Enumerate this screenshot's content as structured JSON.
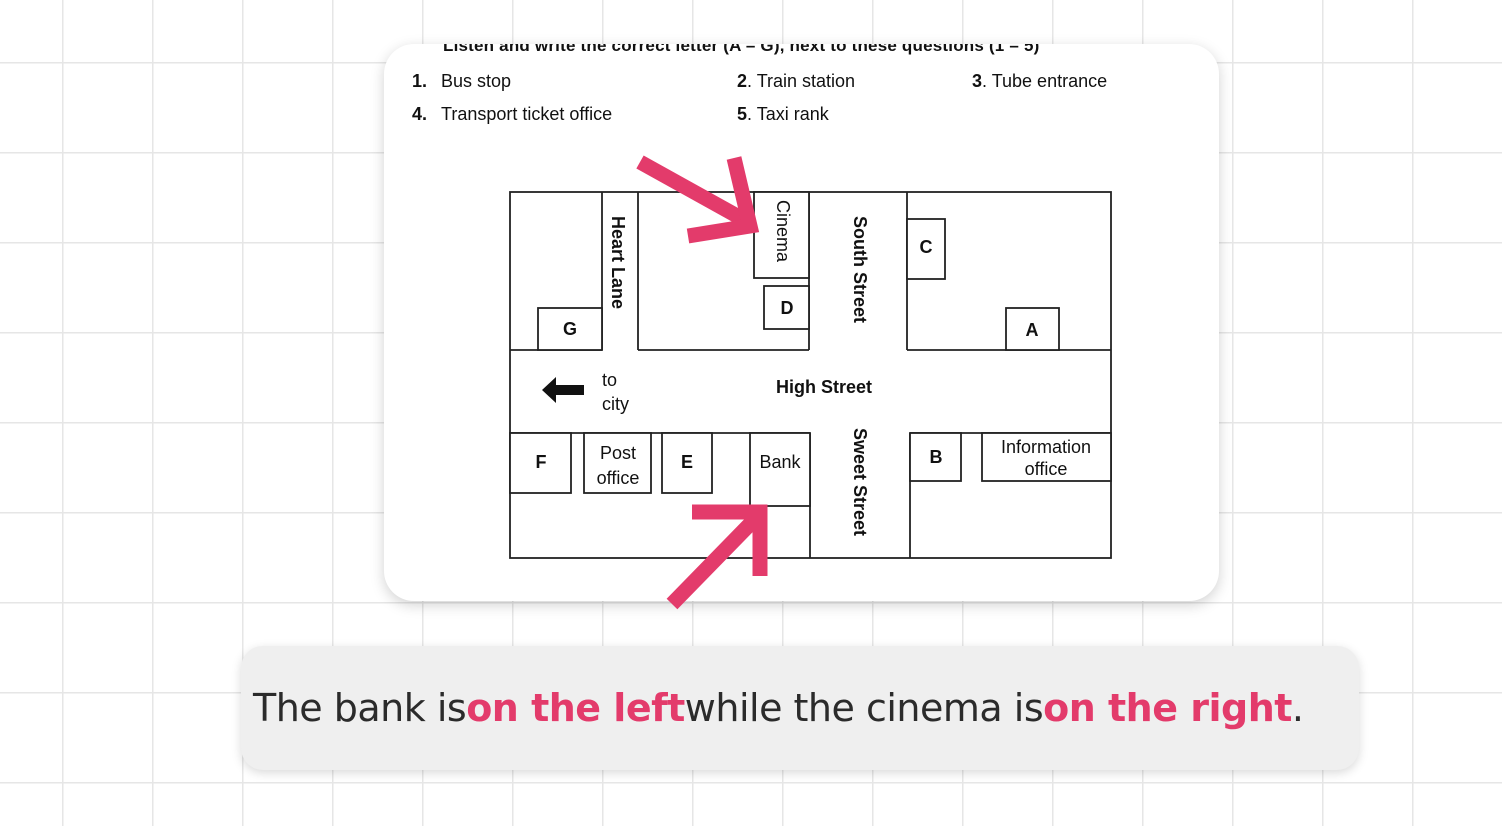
{
  "instructions": "Listen and write the correct letter (A – G), next to these questions (1 – 5)",
  "questions": [
    {
      "num": "1.",
      "text": "Bus stop"
    },
    {
      "num": "2",
      "text": ". Train station"
    },
    {
      "num": "3",
      "text": ". Tube entrance"
    },
    {
      "num": "4.",
      "text": "Transport ticket office"
    },
    {
      "num": "5",
      "text": ". Taxi rank"
    }
  ],
  "map": {
    "letters": [
      "A",
      "B",
      "C",
      "D",
      "E",
      "F",
      "G"
    ],
    "cinema": "Cinema",
    "bank": "Bank",
    "post_office": [
      "Post",
      "office"
    ],
    "information_office": [
      "Information",
      "office"
    ],
    "to_city": [
      "to",
      "city"
    ],
    "streets": {
      "heart_lane": "Heart Lane",
      "south_street": "South Street",
      "high_street": "High Street",
      "sweet_street": "Sweet Street"
    }
  },
  "caption": {
    "part1": "The bank is ",
    "highlight1": "on the left",
    "part2": " while the cinema is ",
    "highlight2": "on the right",
    "part3": "."
  },
  "colors": {
    "accent": "#e33b6b",
    "caption_bg": "#efefef",
    "grid": "#e6e6e6"
  },
  "icons": {
    "to_city_arrow": "left-arrow-icon",
    "pointer_arrows": "pointer-arrow-icon"
  }
}
